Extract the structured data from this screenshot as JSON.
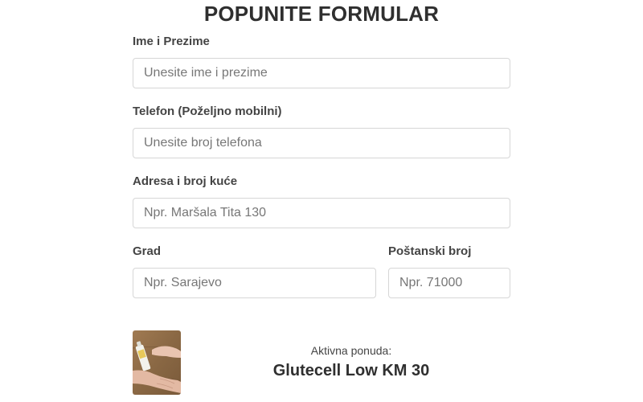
{
  "form": {
    "title": "POPUNITE FORMULAR",
    "name": {
      "label": "Ime i Prezime",
      "placeholder": "Unesite ime i prezime",
      "value": ""
    },
    "phone": {
      "label": "Telefon (Poželjno mobilni)",
      "placeholder": "Unesite broj telefona",
      "value": ""
    },
    "address": {
      "label": "Adresa i broj kuće",
      "placeholder": "Npr. Maršala Tita 130",
      "value": ""
    },
    "city": {
      "label": "Grad",
      "placeholder": "Npr. Sarajevo",
      "value": ""
    },
    "postal": {
      "label": "Poštanski broj",
      "placeholder": "Npr. 71000",
      "value": ""
    }
  },
  "offer": {
    "caption": "Aktivna ponuda:",
    "product_name": "Glutecell Low KM 30",
    "image_icon": "product-photo-hands-with-cream-tube"
  },
  "colors": {
    "input_border": "#d6d6d6",
    "text_dark": "#2f2f2f",
    "label_text": "#444444",
    "placeholder": "#777777"
  }
}
